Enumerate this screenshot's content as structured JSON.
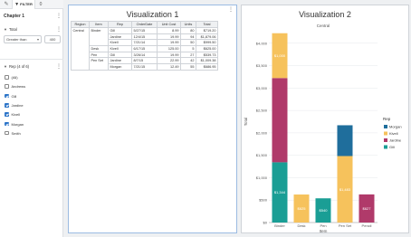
{
  "sidebar": {
    "tabs": {
      "edit_icon": "pencil-icon",
      "filter_label": "FILTER",
      "other_label": "0"
    },
    "chapter_title": "Chapter 1",
    "total_filter": {
      "header": "Total",
      "condition": "Greater than",
      "value": "400"
    },
    "rep_filter": {
      "header": "Rep (4 of 6)",
      "items": [
        {
          "label": "(All)",
          "checked": false
        },
        {
          "label": "Andrews",
          "checked": false
        },
        {
          "label": "Gill",
          "checked": true
        },
        {
          "label": "Jardine",
          "checked": true
        },
        {
          "label": "Kivell",
          "checked": true
        },
        {
          "label": "Morgan",
          "checked": true
        },
        {
          "label": "Smith",
          "checked": false
        }
      ]
    }
  },
  "viz1": {
    "title": "Visualization 1",
    "columns": [
      "Region",
      "Item",
      "Rep",
      "OrderDate",
      "Unit Cost",
      "Units",
      "Total"
    ],
    "region": "Central",
    "groups": [
      {
        "item": "Binder",
        "rows": [
          {
            "rep": "Gill",
            "date": "5/27/15",
            "cost": "8.99",
            "units": "80",
            "total": "$719.20"
          },
          {
            "rep": "Jardine",
            "date": "12/4/15",
            "cost": "19.99",
            "units": "94",
            "total": "$1,879.06"
          },
          {
            "rep": "Kivell",
            "date": "7/21/14",
            "cost": "19.99",
            "units": "50",
            "total": "$999.50"
          }
        ]
      },
      {
        "item": "Desk",
        "rows": [
          {
            "rep": "Kivell",
            "date": "6/17/15",
            "cost": "125.00",
            "units": "5",
            "total": "$625.00"
          }
        ]
      },
      {
        "item": "Pen",
        "rows": [
          {
            "rep": "Gill",
            "date": "3/26/14",
            "cost": "19.99",
            "units": "27",
            "total": "$539.73"
          }
        ]
      },
      {
        "item": "Pen Set",
        "rows": [
          {
            "rep": "Jardine",
            "date": "8/7/15",
            "cost": "22.99",
            "units": "42",
            "total": "$1,009.38"
          },
          {
            "rep": "Morgan",
            "date": "7/21/15",
            "cost": "12.49",
            "units": "55",
            "total": "$686.95"
          }
        ]
      }
    ]
  },
  "viz2": {
    "title": "Visualization 2",
    "subtitle": "Central",
    "legend_title": "Rep",
    "colors": {
      "Morgan": "#1f6e9c",
      "Kivell": "#f6c25c",
      "Jardine": "#b03a6a",
      "Gill": "#1a9e95"
    }
  },
  "chart_data": {
    "type": "bar",
    "stacked": true,
    "title": "Central",
    "xlabel": "Item",
    "ylabel": "Total",
    "ylim": [
      0,
      4500
    ],
    "yticks": [
      "$0",
      "$500",
      "$1,000",
      "$1,500",
      "$2,000",
      "$2,500",
      "$3,000",
      "$3,500",
      "$4,000"
    ],
    "categories": [
      "Binder",
      "Desk",
      "Pen",
      "Pen Set",
      "Pencil"
    ],
    "series": [
      {
        "name": "Gill",
        "values": [
          1344,
          0,
          540,
          0,
          0
        ]
      },
      {
        "name": "Jardine",
        "values": [
          1879,
          0,
          0,
          0,
          627
        ]
      },
      {
        "name": "Kivell",
        "values": [
          1000,
          625,
          0,
          1483,
          0
        ]
      },
      {
        "name": "Morgan",
        "values": [
          0,
          0,
          0,
          687,
          0
        ]
      }
    ],
    "labels": [
      {
        "category": "Binder",
        "series": "Gill",
        "text": "$1,344"
      },
      {
        "category": "Binder",
        "series": "Kivell",
        "text": "$1,000"
      },
      {
        "category": "Desk",
        "series": "Kivell",
        "text": "$625"
      },
      {
        "category": "Pen",
        "series": "Gill",
        "text": "$540"
      },
      {
        "category": "Pen Set",
        "series": "Kivell",
        "text": "$1,483"
      },
      {
        "category": "Pencil",
        "series": "Jardine",
        "text": "$627"
      }
    ],
    "legend": {
      "title": "Rep",
      "position": "right",
      "entries": [
        "Morgan",
        "Kivell",
        "Jardine",
        "Gill"
      ]
    }
  }
}
